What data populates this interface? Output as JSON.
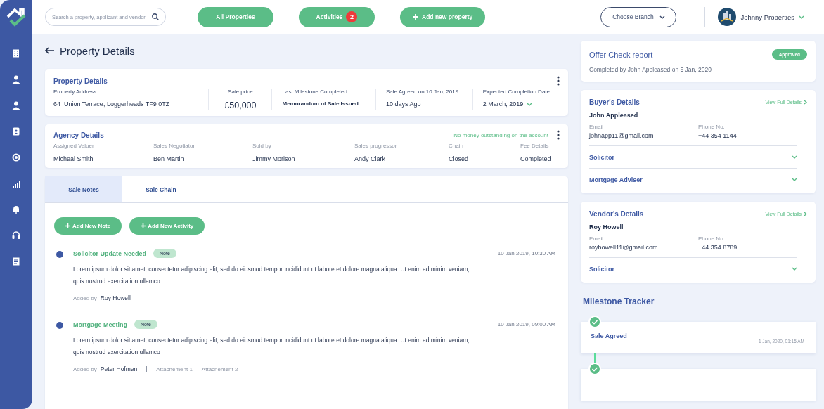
{
  "search": {
    "placeholder": "Search a property, applicant and vendor"
  },
  "nav_buttons": [
    {
      "label": "All Properties",
      "kind": "plain"
    },
    {
      "label": "Activities",
      "kind": "badge",
      "badge": "2"
    },
    {
      "label": "Add new property",
      "kind": "add"
    }
  ],
  "branch": {
    "label": "Choose Branch"
  },
  "account": {
    "name": "Johnny Properties"
  },
  "page_title": "Property Details",
  "property_details": {
    "title": "Property Details",
    "fields": [
      {
        "label": "Property Address",
        "value": "64  Union Terrace, Loggerheads TF9 0TZ",
        "kind": "text"
      },
      {
        "label": "Sale price",
        "value": "£50,000",
        "kind": "price"
      },
      {
        "label": "Last Milestone Completed",
        "value": "Memorandum of Sale Issued",
        "kind": "emphasis"
      },
      {
        "label": "Sale Agreed on 10 Jan, 2019",
        "value": "10 days Ago",
        "kind": "text"
      },
      {
        "label": "Expected Completion Date",
        "value": "2 March, 2019",
        "kind": "dropdown"
      }
    ]
  },
  "agency_details": {
    "title": "Agency Details",
    "notice": "No money outstanding on the account",
    "fields": [
      {
        "label": "Assigned Valuer",
        "value": "Micheal Smith"
      },
      {
        "label": "Sales Negotiator",
        "value": "Ben Martin"
      },
      {
        "label": "Sold by",
        "value": "Jimmy Morison"
      },
      {
        "label": "Sales progressor",
        "value": "Andy Clark"
      },
      {
        "label": "Chain",
        "value": "Closed"
      },
      {
        "label": "Fee Details",
        "value": "Completed"
      }
    ]
  },
  "tabs": [
    {
      "label": "Sale Notes",
      "selected": true
    },
    {
      "label": "Sale Chain",
      "selected": false
    }
  ],
  "note_actions": [
    "Add New Note",
    "Add New Activity"
  ],
  "notes": [
    {
      "title": "Solicitor Update Needed",
      "tag": "Note",
      "time": "10 Jan 2019, 10:30 AM",
      "body": "Lorem ipsum dolor sit amet, consectetur adipiscing elit, sed do eiusmod tempor incididunt ut labore et dolore magna aliqua. Ut enim ad minim veniam, quis nostrud exercitation ullamco",
      "added_by_label": "Added by",
      "added_by": "Roy Howell"
    },
    {
      "title": "Mortgage Meeting",
      "tag": "Note",
      "time": "10 Jan 2019, 09:00 AM",
      "body": "Lorem ipsum dolor sit amet, consectetur adipiscing elit, sed do eiusmod tempor incididunt ut labore et dolore magna aliqua. Ut enim ad minim veniam, quis nostrud exercitation ullamco",
      "added_by_label": "Added by",
      "added_by": "Peter Hofmen",
      "attachments": [
        "Attachement 1",
        "Attachement 2"
      ]
    }
  ],
  "offer_check": {
    "title": "Offer Check report",
    "status": "Approved",
    "subtitle": "Completed by John Appleased on 5 Jan, 2020"
  },
  "contacts": [
    {
      "title": "Buyer's Details",
      "link": "View Full Details",
      "name": "John Appleased",
      "fields": [
        {
          "label": "Email",
          "value": "johnapp11@gmail.com"
        },
        {
          "label": "Phone No.",
          "value": "+44 354 1144"
        }
      ],
      "sections": [
        {
          "label": "Solicitor",
          "expanded": false
        },
        {
          "label": "Mortgage Adviser",
          "expanded": false
        }
      ]
    },
    {
      "title": "Vendor's Details",
      "link": "View Full Details",
      "name": "Roy Howell",
      "fields": [
        {
          "label": "Email",
          "value": "royhowell11@gmail.com"
        },
        {
          "label": "Phone No.",
          "value": "+44 354 8789"
        }
      ],
      "sections": [
        {
          "label": "Solicitor",
          "expanded": false
        }
      ]
    }
  ],
  "milestone_tracker": {
    "title": "Milestone Tracker",
    "items": [
      {
        "label": "Sale Agreed",
        "time": "1 Jan, 2020, 01:15 AM",
        "done": true
      },
      {
        "done": true
      }
    ]
  }
}
